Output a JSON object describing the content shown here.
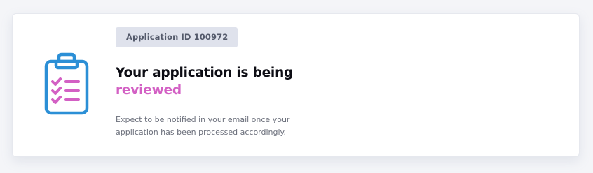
{
  "card": {
    "badge_label": "Application ID 100972",
    "title_line1": "Your application is being",
    "title_highlight": "reviewed",
    "description": "Expect to be notified in your email once your application has been processed accordingly.",
    "icon": "clipboard-checklist-icon"
  },
  "colors": {
    "accent": "#d360c4",
    "icon_blue": "#2b8fd6",
    "badge_bg": "#dfe2ec"
  }
}
